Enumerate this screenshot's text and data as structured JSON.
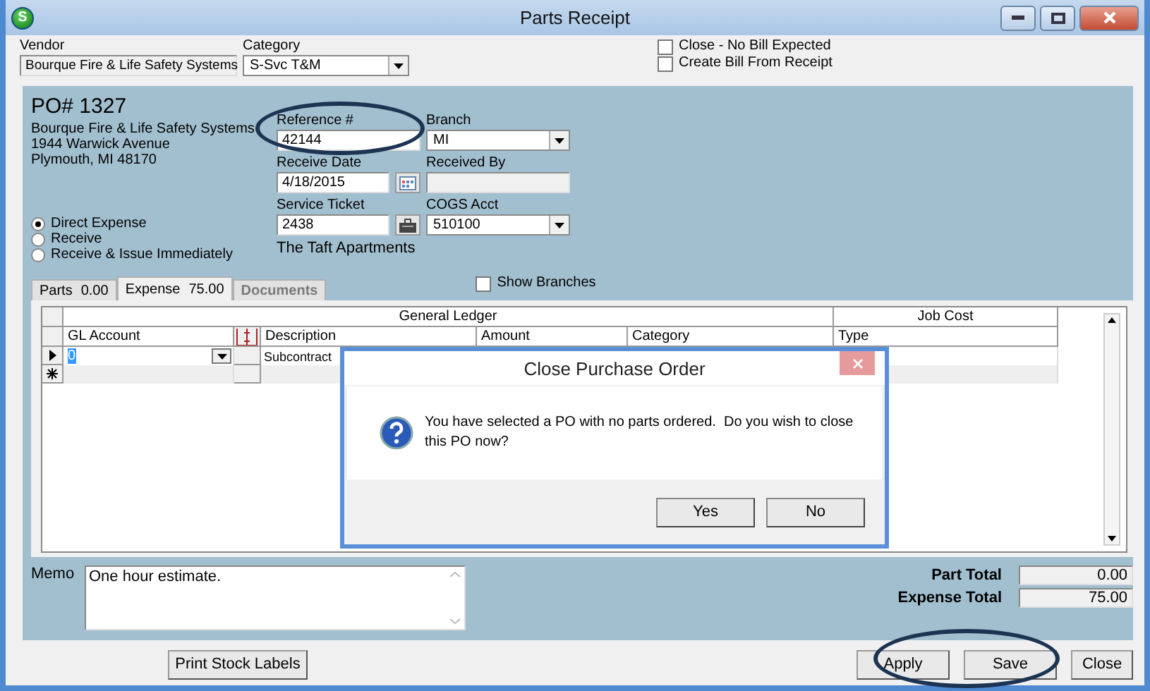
{
  "window": {
    "title": "Parts Receipt",
    "logo": "S"
  },
  "vendor": {
    "label": "Vendor",
    "value": "Bourque Fire & Life Safety Systems"
  },
  "category": {
    "label": "Category",
    "value": "S-Svc T&M"
  },
  "options": [
    {
      "label": "Close - No Bill Expected",
      "checked": false
    },
    {
      "label": "Create Bill From Receipt",
      "checked": false
    }
  ],
  "po": {
    "number": "PO# 1327",
    "address": [
      "Bourque Fire & Life Safety Systems",
      "1944 Warwick Avenue",
      "Plymouth, MI  48170"
    ]
  },
  "receipt_types": [
    {
      "label": "Direct Expense",
      "selected": true
    },
    {
      "label": "Receive",
      "selected": false
    },
    {
      "label": "Receive & Issue Immediately",
      "selected": false
    }
  ],
  "reference": {
    "label": "Reference #",
    "value": "42144"
  },
  "branch": {
    "label": "Branch",
    "value": "MI"
  },
  "receive_date": {
    "label": "Receive Date",
    "value": "4/18/2015"
  },
  "received_by": {
    "label": "Received By"
  },
  "service_ticket": {
    "label": "Service Ticket",
    "value": "2438"
  },
  "cogs_acct": {
    "label": "COGS Acct",
    "value": "510100"
  },
  "job_name": "The Taft Apartments",
  "show_branches": {
    "label": "Show Branches",
    "checked": false
  },
  "tabs": [
    {
      "label": "Parts",
      "amount": "0.00",
      "selected": false,
      "disabled": false
    },
    {
      "label": "Expense",
      "amount": "75.00",
      "selected": true,
      "disabled": false
    },
    {
      "label": "Documents",
      "selected": false,
      "disabled": true
    }
  ],
  "grid": {
    "groups": [
      "General Ledger",
      "Job Cost"
    ],
    "columns": [
      "GL Account",
      "Description",
      "Amount",
      "Category",
      "Type"
    ],
    "rows": [
      {
        "current": true,
        "gl_account": "0",
        "description": "Subcontract"
      }
    ],
    "new_row": true
  },
  "memo": {
    "label": "Memo",
    "value": "One hour estimate."
  },
  "totals": [
    {
      "label": "Part Total",
      "value": "0.00"
    },
    {
      "label": "Expense Total",
      "value": "75.00"
    }
  ],
  "print_button": "Print Stock Labels",
  "actions": [
    "Apply",
    "Save",
    "Close"
  ],
  "dialog": {
    "title": "Close Purchase Order",
    "message": "You have selected a PO with no parts ordered.  Do you wish to close this PO now?",
    "buttons": [
      "Yes",
      "No"
    ]
  }
}
